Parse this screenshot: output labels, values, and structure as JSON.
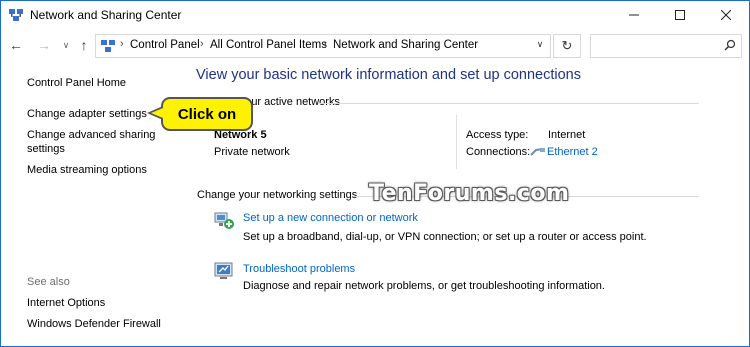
{
  "window": {
    "title": "Network and Sharing Center"
  },
  "address_bar": {
    "crumbs": [
      "Control Panel",
      "All Control Panel Items",
      "Network and Sharing Center"
    ],
    "search_placeholder": ""
  },
  "left_pane": {
    "home": "Control Panel Home",
    "links": [
      "Change adapter settings",
      "Change advanced sharing",
      "settings",
      "Media streaming options"
    ],
    "see_also_label": "See also",
    "see_also": [
      "Internet Options",
      "Windows Defender Firewall"
    ]
  },
  "main": {
    "title": "View your basic network information and set up connections",
    "active_networks_heading": "View your active networks",
    "network": {
      "name": "Network 5",
      "category": "Private network",
      "access_type_label": "Access type:",
      "access_type_value": "Internet",
      "connections_label": "Connections:",
      "connections_value": "Ethernet 2"
    },
    "change_heading": "Change your networking settings",
    "tasks": [
      {
        "link": "Set up a new connection or network",
        "desc": "Set up a broadband, dial-up, or VPN connection; or set up a router or access point."
      },
      {
        "link": "Troubleshoot problems",
        "desc": "Diagnose and repair network problems, or get troubleshooting information."
      }
    ]
  },
  "annotation": {
    "callout": "Click on"
  },
  "watermark": "TenForums.com",
  "colors": {
    "link": "#0066cc",
    "title": "#1e3287",
    "callout": "#fff200",
    "border": "#1a6fc4"
  }
}
